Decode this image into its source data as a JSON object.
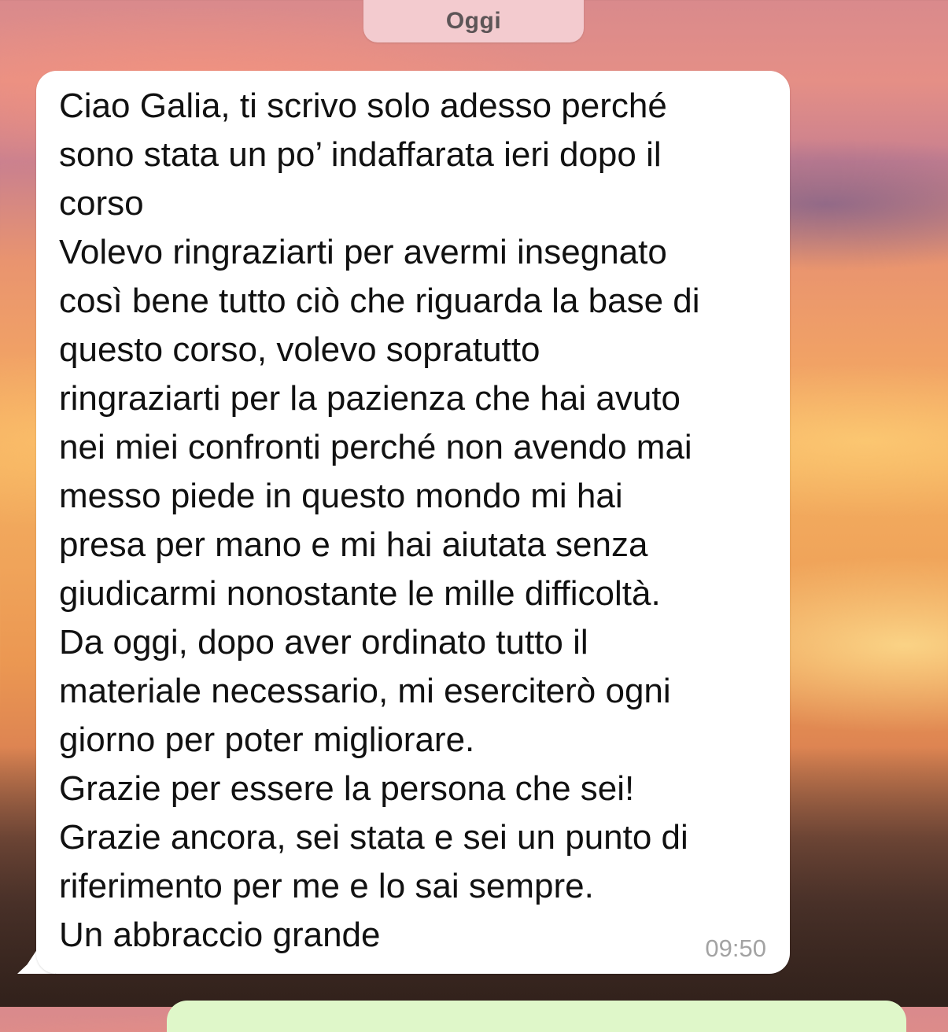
{
  "date_separator": {
    "label": "Oggi"
  },
  "message": {
    "lines": [
      "Ciao Galia, ti scrivo solo adesso perché",
      "sono stata un po’ indaffarata ieri dopo il",
      "corso",
      "Volevo ringraziarti per avermi insegnato",
      "così bene tutto ciò che riguarda la base di",
      "questo corso, volevo sopratutto",
      "ringraziarti per la pazienza che hai avuto",
      "nei miei confronti perché non avendo mai",
      "messo piede in questo mondo mi hai",
      "presa per mano e mi hai aiutata senza",
      "giudicarmi nonostante le mille difficoltà.",
      "Da oggi, dopo aver ordinato tutto il",
      "materiale necessario, mi eserciterò ogni",
      "giorno per poter migliorare.",
      "Grazie per essere la persona che sei!",
      "Grazie ancora, sei stata e sei un punto di",
      "riferimento per me e lo sai sempre.",
      "Un abbraccio grande"
    ],
    "time": "09:50",
    "bubble_color": "#ffffff",
    "outgoing_bubble_color": "#dff7c9"
  }
}
